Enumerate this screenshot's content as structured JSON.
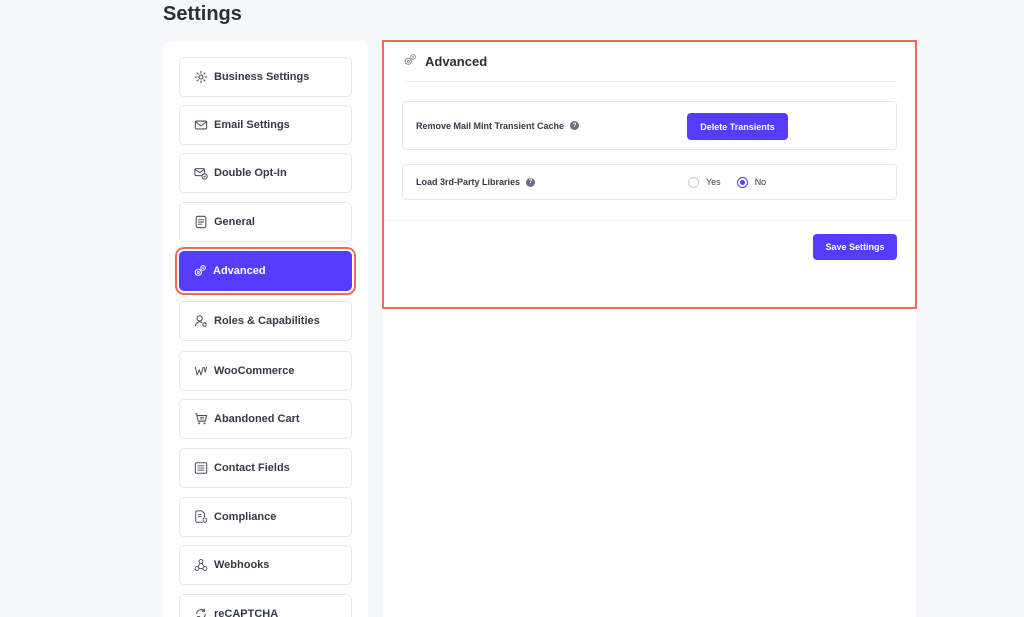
{
  "page": {
    "title": "Settings"
  },
  "sidebar": {
    "items": [
      {
        "label": "Business Settings",
        "icon": "gear-icon"
      },
      {
        "label": "Email Settings",
        "icon": "envelope-icon"
      },
      {
        "label": "Double Opt-In",
        "icon": "envelope-check-icon"
      },
      {
        "label": "General",
        "icon": "document-icon"
      },
      {
        "label": "Advanced",
        "icon": "gears-icon",
        "active": true
      },
      {
        "label": "Roles & Capabilities",
        "icon": "user-gear-icon"
      },
      {
        "label": "WooCommerce",
        "icon": "woocommerce-icon"
      },
      {
        "label": "Abandoned Cart",
        "icon": "cart-icon"
      },
      {
        "label": "Contact Fields",
        "icon": "list-icon"
      },
      {
        "label": "Compliance",
        "icon": "shield-document-icon"
      },
      {
        "label": "Webhooks",
        "icon": "webhook-icon"
      },
      {
        "label": "reCAPTCHA",
        "icon": "recaptcha-icon"
      }
    ]
  },
  "panel": {
    "title": "Advanced",
    "transient": {
      "label": "Remove Mail Mint Transient Cache",
      "button": "Delete Transients"
    },
    "libraries": {
      "label": "Load 3rd-Party Libraries",
      "options": [
        "Yes",
        "No"
      ],
      "selected": "No"
    },
    "save_button": "Save Settings"
  },
  "colors": {
    "accent": "#573bff",
    "highlight": "#ef6a5a"
  }
}
